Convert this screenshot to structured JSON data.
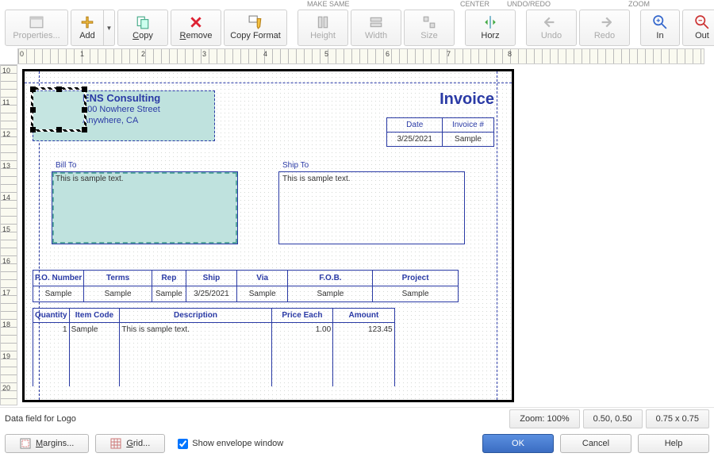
{
  "toolbar_groups": {
    "make_same": "MAKE SAME",
    "center": "CENTER",
    "undo_redo": "UNDO/REDO",
    "zoom": "ZOOM"
  },
  "toolbar": {
    "properties": "Properties...",
    "add": "Add",
    "copy": "Copy",
    "remove": "Remove",
    "copy_format": "Copy Format",
    "height": "Height",
    "width": "Width",
    "size": "Size",
    "horz": "Horz",
    "undo": "Undo",
    "redo": "Redo",
    "zoom_in": "In",
    "zoom_out": "Out"
  },
  "ruler_h": [
    "0",
    "1",
    "2",
    "3",
    "4",
    "5",
    "6",
    "7",
    "8"
  ],
  "ruler_v": [
    "10",
    "11",
    "12",
    "13",
    "14",
    "15",
    "16",
    "17",
    "18",
    "19",
    "20"
  ],
  "invoice": {
    "company_name": "ENS Consulting",
    "company_addr1": "100 Nowhere Street",
    "company_addr2": "Anywhere, CA",
    "title": "Invoice",
    "date_hdr": "Date",
    "invoice_num_hdr": "Invoice #",
    "date_val": "3/25/2021",
    "invoice_num_val": "Sample",
    "bill_to": "Bill To",
    "ship_to": "Ship To",
    "sample_text": "This is sample text.",
    "po_headers": {
      "po": "P.O. Number",
      "terms": "Terms",
      "rep": "Rep",
      "ship": "Ship",
      "via": "Via",
      "fob": "F.O.B.",
      "project": "Project"
    },
    "po_vals": {
      "po": "Sample",
      "terms": "Sample",
      "rep": "Sample",
      "ship": "3/25/2021",
      "via": "Sample",
      "fob": "Sample",
      "project": "Sample"
    },
    "line_headers": {
      "qty": "Quantity",
      "item": "Item Code",
      "desc": "Description",
      "price": "Price Each",
      "amount": "Amount"
    },
    "line_vals": {
      "qty": "1",
      "item": "Sample",
      "desc": "This is sample text.",
      "price": "1.00",
      "amount": "123.45"
    }
  },
  "status": {
    "field_info": "Data field for Logo",
    "zoom": "Zoom: 100%",
    "pos": "0.50, 0.50",
    "size": "0.75 x 0.75"
  },
  "bottom": {
    "margins": "Margins...",
    "grid": "Grid...",
    "envelope": "Show envelope window",
    "ok": "OK",
    "cancel": "Cancel",
    "help": "Help"
  }
}
